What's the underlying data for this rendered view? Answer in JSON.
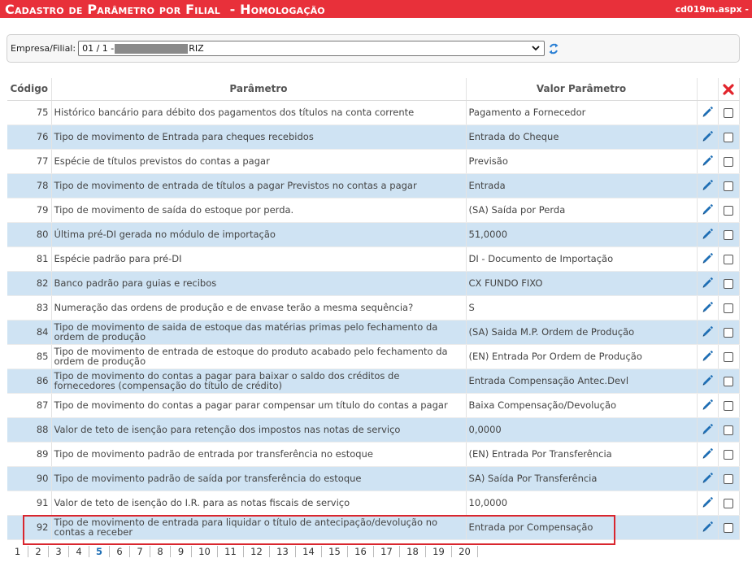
{
  "header": {
    "title": "Cadastro de Parâmetro por Filial",
    "env_suffix": "- Homologação",
    "page_code": "cd019m.aspx -"
  },
  "filter": {
    "label": "Empresa/Filial:",
    "value_prefix": "01 / 1 -",
    "value_suffix": "RIZ"
  },
  "table": {
    "columns": [
      "Código",
      "Parâmetro",
      "Valor Parâmetro"
    ],
    "rows": [
      {
        "code": "75",
        "param": "Histórico bancário para débito dos pagamentos dos títulos na conta corrente",
        "value": "Pagamento a Fornecedor"
      },
      {
        "code": "76",
        "param": "Tipo de movimento de Entrada para cheques recebidos",
        "value": "Entrada do Cheque"
      },
      {
        "code": "77",
        "param": "Espécie de títulos previstos do contas a pagar",
        "value": "Previsão"
      },
      {
        "code": "78",
        "param": "Tipo de movimento de entrada de títulos a pagar Previstos no contas a pagar",
        "value": "Entrada"
      },
      {
        "code": "79",
        "param": "Tipo de movimento de saída do estoque por perda.",
        "value": "(SA) Saída por Perda"
      },
      {
        "code": "80",
        "param": "Última pré-DI gerada no módulo de importação",
        "value": "51,0000"
      },
      {
        "code": "81",
        "param": "Espécie padrão para pré-DI",
        "value": "DI - Documento de Importação"
      },
      {
        "code": "82",
        "param": "Banco padrão para guias e recibos",
        "value": "CX FUNDO FIXO"
      },
      {
        "code": "83",
        "param": "Numeração das ordens de produção e de envase terão a mesma sequência?",
        "value": "S"
      },
      {
        "code": "84",
        "param": "Tipo de movimento de saida de estoque das matérias primas pelo fechamento da ordem de produção",
        "value": "(SA) Saida M.P. Ordem de Produção"
      },
      {
        "code": "85",
        "param": "Tipo de movimento de entrada de estoque do produto acabado pelo fechamento da ordem de produção",
        "value": "(EN) Entrada Por Ordem de Produção"
      },
      {
        "code": "86",
        "param": "Tipo de movimento do contas a pagar para baixar o saldo dos créditos de fornecedores (compensação do título de crédito)",
        "value": "Entrada Compensação Antec.Devl"
      },
      {
        "code": "87",
        "param": "Tipo de movimento do contas a pagar parar compensar um título do contas a pagar",
        "value": "Baixa Compensação/Devolução"
      },
      {
        "code": "88",
        "param": "Valor de teto de isenção para retenção dos impostos nas notas de serviço",
        "value": "0,0000"
      },
      {
        "code": "89",
        "param": "Tipo de movimento padrão de entrada por transferência no estoque",
        "value": "(EN) Entrada Por Transferência"
      },
      {
        "code": "90",
        "param": "Tipo de movimento padrão de saída por transferência do estoque",
        "value": "SA) Saída Por Transferência"
      },
      {
        "code": "91",
        "param": "Valor de teto de isenção do I.R. para as notas fiscais de serviço",
        "value": "10,0000"
      },
      {
        "code": "92",
        "param": "Tipo de movimento de entrada para liquidar o título de antecipação/devolução no contas a receber",
        "value": "Entrada por Compensação"
      }
    ]
  },
  "pagination": {
    "pages": [
      "1",
      "2",
      "3",
      "4",
      "5",
      "6",
      "7",
      "8",
      "9",
      "10",
      "11",
      "12",
      "13",
      "14",
      "15",
      "16",
      "17",
      "18",
      "19",
      "20"
    ],
    "current": "5"
  },
  "icons": {
    "edit": "pencil-icon",
    "delete": "red-x-icon",
    "refresh": "refresh-icon"
  },
  "colors": {
    "header_bg": "#e8303a",
    "row_alt": "#cfe3f3",
    "highlight": "#d9262e",
    "edit_icon": "#1f6fb5"
  }
}
